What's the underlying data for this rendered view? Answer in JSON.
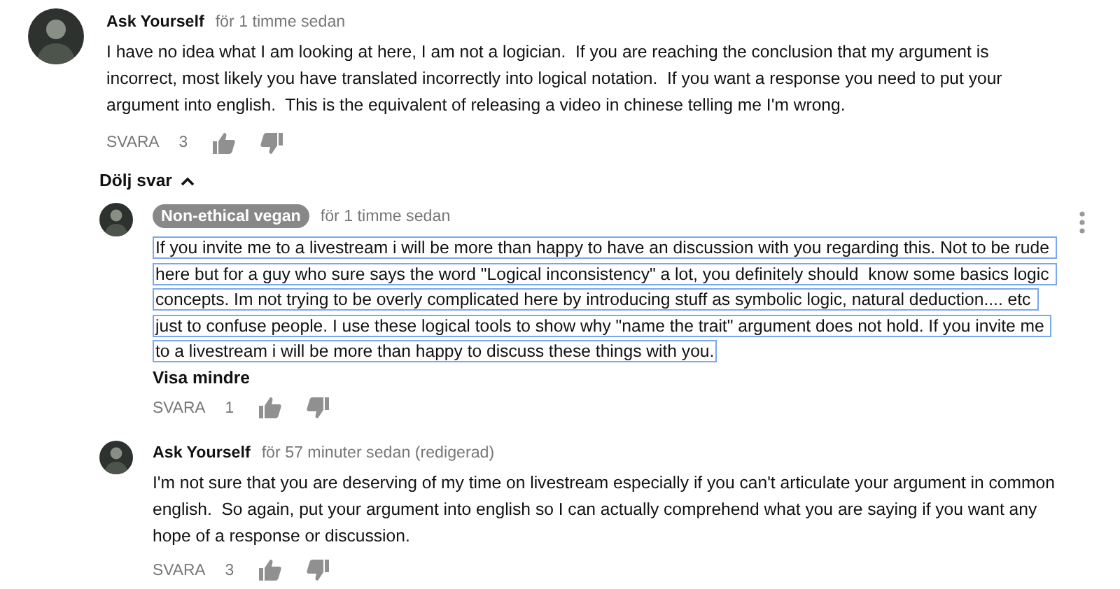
{
  "comment": {
    "author": "Ask Yourself",
    "owner": false,
    "time": "för 1 timme sedan",
    "body": "I have no idea what I am looking at here, I am not a logician.  If you are reaching the conclusion that my argument is incorrect, most likely you have translated incorrectly into logical notation.  If you want a response you need to put your argument into english.  This is the equivalent of releasing a video in chinese telling me I'm wrong.",
    "selected": false,
    "reply_label": "SVARA",
    "likes": "3",
    "menu_visible": false
  },
  "replies_toggle": {
    "label": "Dölj svar",
    "expanded": true
  },
  "replies": [
    {
      "author": "Non-ethical vegan",
      "owner": true,
      "time": "för 1 timme sedan",
      "body": "If you invite me to a livestream i will be more than happy to have an discussion with you regarding this. Not to be rude here but for a guy who sure says the word \"Logical inconsistency\" a lot, you definitely should  know some basics logic concepts. Im not trying to be overly complicated here by introducing stuff as symbolic logic, natural deduction.... etc just to confuse people. I use these logical tools to show why \"name the trait\" argument does not hold. If you invite me to a livestream i will be more than happy to discuss these things with you.",
      "selected": true,
      "less_label": "Visa mindre",
      "reply_label": "SVARA",
      "likes": "1",
      "menu_visible": true
    },
    {
      "author": "Ask Yourself",
      "owner": false,
      "time": "för 57 minuter sedan (redigerad)",
      "body": "I'm not sure that you are deserving of my time on livestream especially if you can't articulate your argument in common english.  So again, put your argument into english so I can actually comprehend what you are saying if you want any hope of a response or discussion.",
      "selected": false,
      "reply_label": "SVARA",
      "likes": "3",
      "menu_visible": false
    }
  ]
}
